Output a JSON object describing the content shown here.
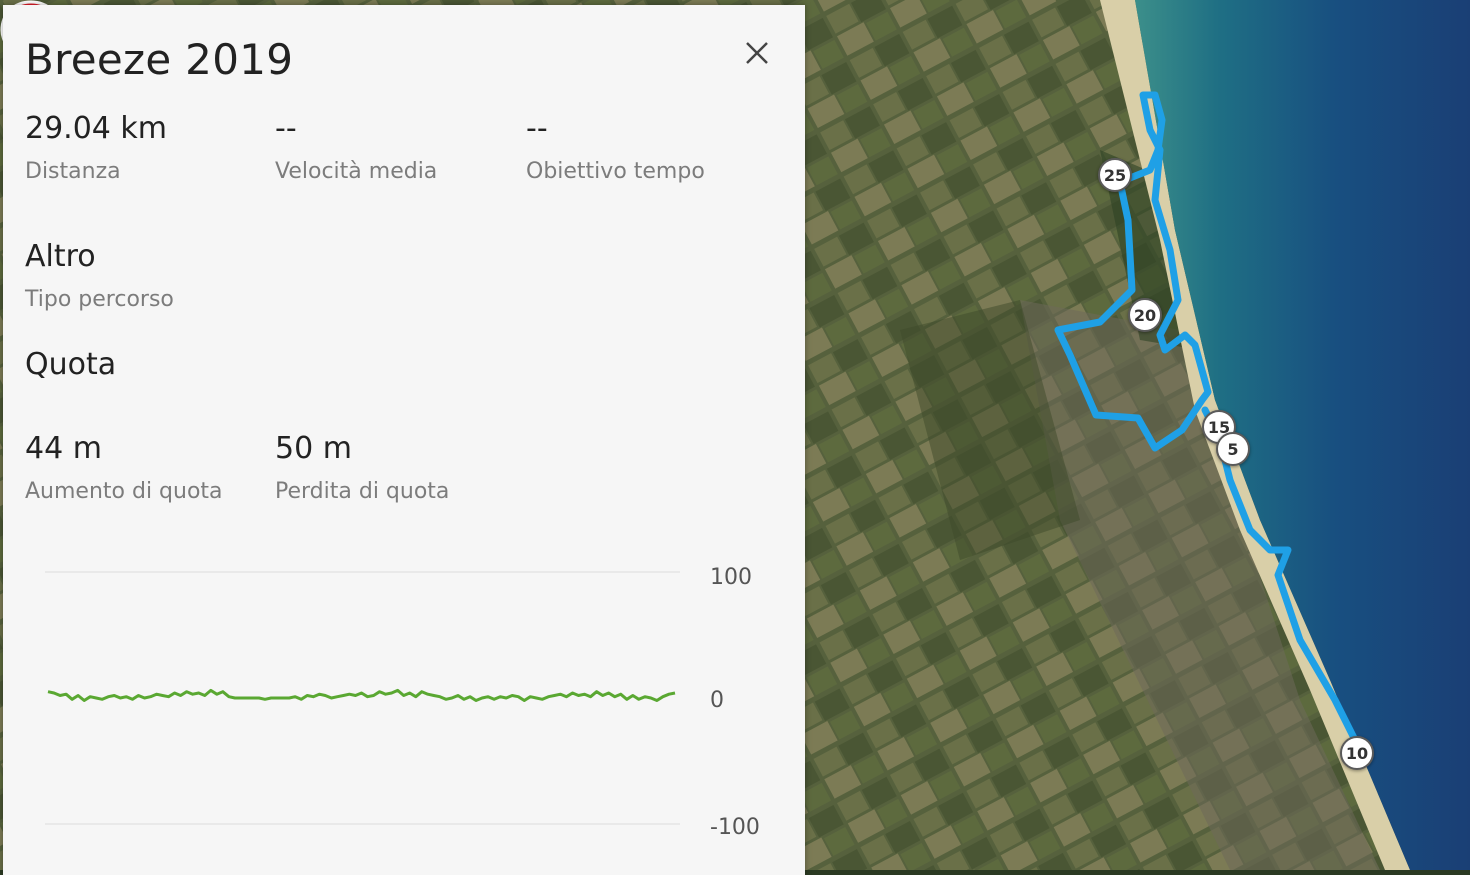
{
  "route": {
    "title": "Breeze 2019",
    "stats": [
      {
        "value": "29.04 km",
        "label": "Distanza"
      },
      {
        "value": "--",
        "label": "Velocità media"
      },
      {
        "value": "--",
        "label": "Obiettivo tempo"
      }
    ],
    "type_value": "Altro",
    "type_label": "Tipo percorso",
    "elevation_heading": "Quota",
    "elevation_stats": [
      {
        "value": "44 m",
        "label": "Aumento di quota"
      },
      {
        "value": "50 m",
        "label": "Perdita di quota"
      }
    ]
  },
  "chart_data": {
    "type": "line",
    "ylim": [
      -100,
      100
    ],
    "yticks": [
      "100",
      "0",
      "-100"
    ],
    "series_color": "#5aa832",
    "values": [
      5,
      4,
      2,
      3,
      -1,
      2,
      -2,
      1,
      0,
      -1,
      1,
      2,
      0,
      1,
      -1,
      2,
      0,
      1,
      3,
      2,
      1,
      4,
      2,
      5,
      3,
      4,
      2,
      6,
      3,
      5,
      1,
      0,
      0,
      0,
      0,
      0,
      -1,
      0,
      0,
      0,
      0,
      1,
      -1,
      2,
      1,
      3,
      2,
      0,
      1,
      2,
      3,
      2,
      4,
      1,
      2,
      5,
      3,
      4,
      6,
      2,
      4,
      1,
      5,
      3,
      2,
      1,
      -1,
      0,
      2,
      -1,
      1,
      -2,
      0,
      1,
      -1,
      1,
      0,
      2,
      1,
      -2,
      1,
      0,
      -1,
      1,
      2,
      3,
      1,
      4,
      2,
      3,
      1,
      5,
      2,
      4,
      1,
      3,
      -1,
      2,
      -1,
      1,
      0,
      -2,
      1,
      3,
      4
    ]
  },
  "map": {
    "km_markers": [
      "25",
      "20",
      "15",
      "5",
      "10"
    ],
    "route_color": "#1fa0e6",
    "pin_color": "#e0202a"
  }
}
